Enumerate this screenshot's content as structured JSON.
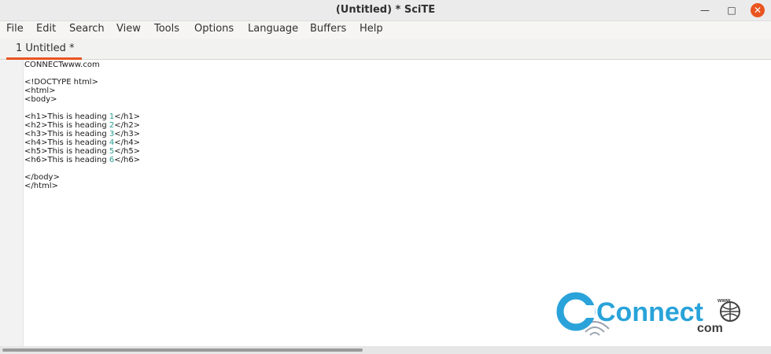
{
  "window": {
    "title": "(Untitled) * SciTE"
  },
  "menu": [
    "File",
    "Edit",
    "Search",
    "View",
    "Tools",
    "Options",
    "Language",
    "Buffers",
    "Help"
  ],
  "tab": {
    "label": "1 Untitled *"
  },
  "editor": {
    "lines": [
      "CONNECTwww.com",
      "",
      "<!DOCTYPE html>",
      "<html>",
      "<body>",
      "",
      "<h1>This is heading 1</h1>",
      "<h2>This is heading 2</h2>",
      "<h3>This is heading 3</h3>",
      "<h4>This is heading 4</h4>",
      "<h5>This is heading 5</h5>",
      "<h6>This is heading 6</h6>",
      "",
      "</body>",
      "</html>"
    ],
    "heading_lines": [
      {
        "pre": "<h1>This is heading ",
        "num": "1",
        "post": "</h1>"
      },
      {
        "pre": "<h2>This is heading ",
        "num": "2",
        "post": "</h2>"
      },
      {
        "pre": "<h3>This is heading ",
        "num": "3",
        "post": "</h3>"
      },
      {
        "pre": "<h4>This is heading ",
        "num": "4",
        "post": "</h4>"
      },
      {
        "pre": "<h5>This is heading ",
        "num": "5",
        "post": "</h5>"
      },
      {
        "pre": "<h6>This is heading ",
        "num": "6",
        "post": "</h6>"
      }
    ]
  },
  "watermark": {
    "brand": "Connect",
    "suffix": "com",
    "tag": "www"
  },
  "colors": {
    "accent": "#e95420",
    "number": "#2a9d8f",
    "brand_blue": "#29a3d9"
  }
}
